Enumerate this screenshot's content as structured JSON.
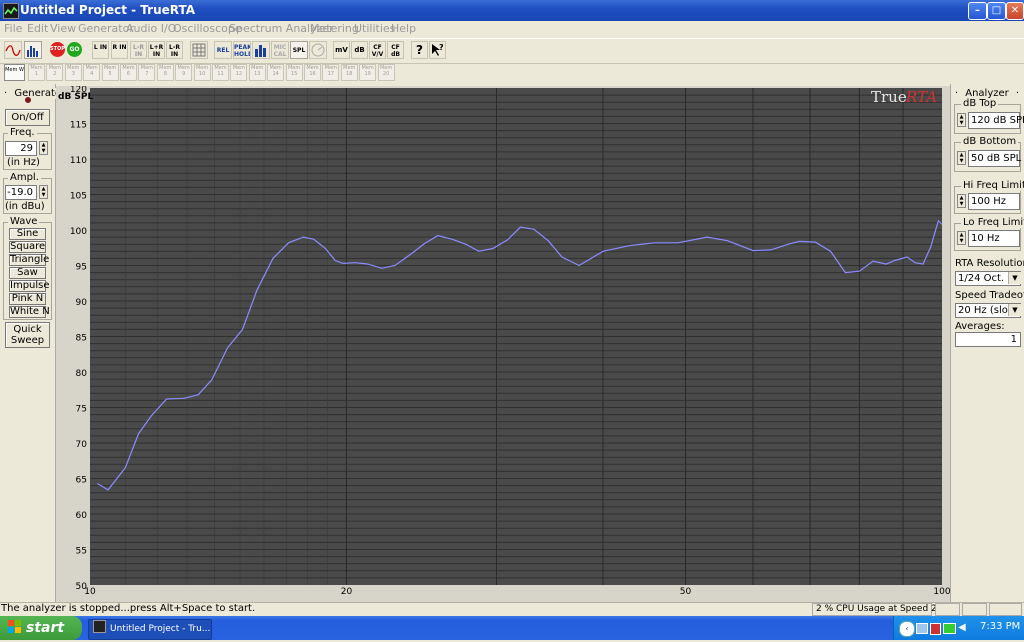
{
  "window": {
    "title": "Untitled Project - TrueRTA"
  },
  "menu": [
    "File",
    "Edit",
    "View",
    "Generator",
    "Audio I/O",
    "Oscilloscope",
    "Spectrum Analyzer",
    "Metering",
    "Utilities",
    "Help"
  ],
  "toolbar": {
    "buttons": [
      "L IN",
      "R IN",
      "L-R IN",
      "L+R IN",
      "L-R IN",
      "REL",
      "PEAK HOLD",
      "MIC CAL",
      "SPL",
      "mV",
      "dB",
      "CF V/V",
      "CF dB",
      "?"
    ],
    "stop_label": "STOP",
    "go_label": "GO"
  },
  "memories": {
    "first": "Mem W",
    "items": [
      "Mem 1",
      "Mem 2",
      "Mem 3",
      "Mem 4",
      "Mem 5",
      "Mem 6",
      "Mem 7",
      "Mem 8",
      "Mem 9",
      "Mem 10",
      "Mem 11",
      "Mem 12",
      "Mem 13",
      "Mem 14",
      "Mem 15",
      "Mem 16",
      "Mem 17",
      "Mem 18",
      "Mem 19",
      "Mem 20"
    ]
  },
  "generator": {
    "title": "Generator",
    "on_off": "On/Off",
    "freq_label": "Freq.",
    "freq_value": "29",
    "freq_unit": "(in Hz)",
    "ampl_label": "Ampl.",
    "ampl_value": "-19.0",
    "ampl_unit": "(in dBu)",
    "wave_label": "Wave",
    "waves": [
      "Sine",
      "Square",
      "Triangle",
      "Saw",
      "Impulse",
      "Pink N",
      "White N"
    ],
    "quick_sweep_1": "Quick",
    "quick_sweep_2": "Sweep"
  },
  "analyzer": {
    "title": "Analyzer",
    "db_top_label": "dB Top",
    "db_top": "120 dB SPL",
    "db_bottom_label": "dB Bottom",
    "db_bottom": "50 dB SPL",
    "hi_freq_label": "Hi Freq Limit",
    "hi_freq": "100 Hz",
    "lo_freq_label": "Lo Freq Limit",
    "lo_freq": "10 Hz",
    "rta_res_label": "RTA Resolution:",
    "rta_res": "1/24 Oct.",
    "speed_label": "Speed Tradeoff:",
    "speed": "20 Hz (slow)",
    "averages_label": "Averages:",
    "averages": "1"
  },
  "status": {
    "message": "The analyzer is stopped...press Alt+Space to start.",
    "cpu": "2 % CPU Usage at Speed 2"
  },
  "taskbar": {
    "start": "start",
    "task": "Untitled Project - Tru...",
    "clock": "7:33 PM"
  },
  "chart_data": {
    "type": "line",
    "logo_a": "True",
    "logo_b": "RTA",
    "y_unit": "dB SPL",
    "ylim": [
      50,
      120
    ],
    "xlim": [
      10,
      100
    ],
    "x_scale": "log",
    "grid": true,
    "background": "#4a4a4a",
    "line_color": "#8c8cff",
    "y_ticks": [
      "120",
      "115",
      "110",
      "105",
      "100",
      "95",
      "90",
      "85",
      "80",
      "75",
      "70",
      "65",
      "60",
      "55",
      "50"
    ],
    "x_ticks": [
      "10",
      "20",
      "50",
      "100"
    ],
    "series": [
      {
        "x": [
          10.2,
          10.5,
          11.0,
          11.4,
          11.8,
          12.3,
          12.9,
          13.4,
          13.9,
          14.5,
          15.1,
          15.7,
          16.4,
          17.1,
          17.8,
          18.3,
          18.9,
          19.4,
          19.8,
          20.5,
          21.2,
          22.0,
          22.8,
          23.8,
          24.7,
          25.6,
          26.6,
          27.6,
          28.6,
          29.7,
          30.9,
          32.0,
          33.2,
          34.5,
          35.8,
          37.5,
          40.0,
          43.0,
          46.0,
          49.0,
          53.0,
          56.0,
          60.0,
          63.0,
          66.0,
          68.0,
          71.0,
          74.0,
          77.0,
          80.0,
          83.0,
          86.0,
          88.0,
          91.0,
          93.0,
          95.0,
          97.0,
          99.0,
          100.0
        ],
        "y": [
          64.3,
          63.4,
          66.5,
          71.3,
          73.8,
          76.2,
          76.3,
          76.8,
          78.9,
          83.4,
          86.0,
          91.5,
          96.0,
          98.2,
          99.0,
          98.7,
          97.4,
          95.7,
          95.3,
          95.4,
          95.2,
          94.6,
          95.0,
          96.6,
          98.1,
          99.2,
          98.7,
          98.0,
          97.0,
          97.4,
          98.6,
          100.4,
          100.1,
          98.5,
          96.2,
          95.0,
          97.0,
          97.8,
          98.2,
          98.2,
          99.0,
          98.5,
          97.1,
          97.2,
          98.0,
          98.4,
          98.3,
          97.0,
          94.0,
          94.2,
          95.6,
          95.2,
          95.7,
          96.2,
          95.4,
          95.2,
          97.6,
          101.3,
          100.8
        ]
      }
    ]
  }
}
